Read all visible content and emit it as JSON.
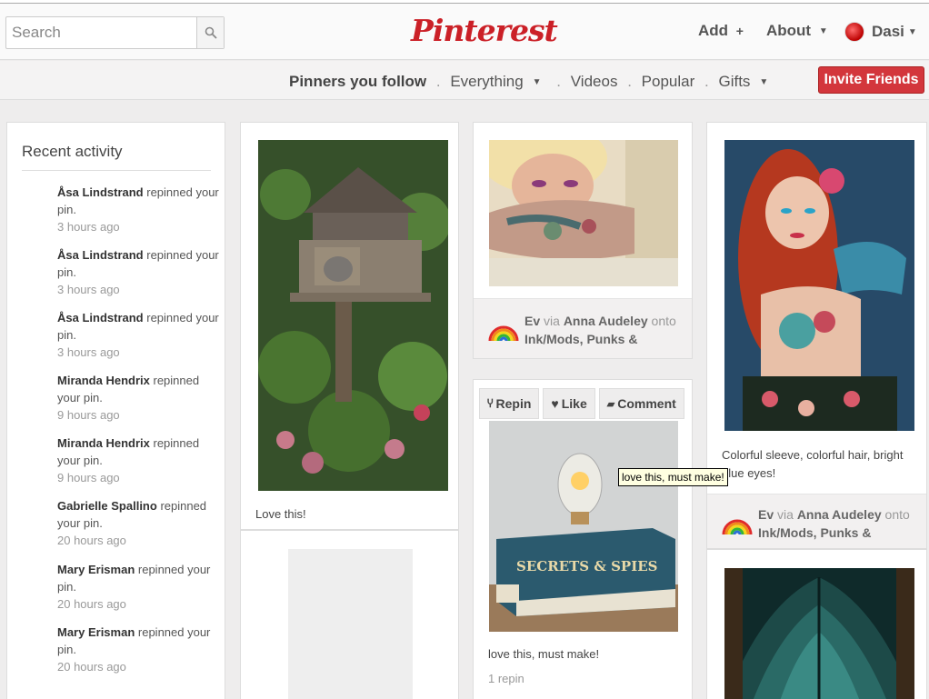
{
  "header": {
    "search_placeholder": "Search",
    "logo": "Pinterest",
    "add_label": "Add",
    "about_label": "About",
    "user_name": "Dasi"
  },
  "subnav": {
    "items": [
      "Pinners you follow",
      "Everything",
      "Videos",
      "Popular",
      "Gifts"
    ],
    "invite_label": "Invite Friends"
  },
  "activity": {
    "title": "Recent activity",
    "items": [
      {
        "name": "Åsa Lindstrand",
        "action": "repinned your pin.",
        "time": "3 hours ago"
      },
      {
        "name": "Åsa Lindstrand",
        "action": "repinned your pin.",
        "time": "3 hours ago"
      },
      {
        "name": "Åsa Lindstrand",
        "action": "repinned your pin.",
        "time": "3 hours ago"
      },
      {
        "name": "Miranda Hendrix",
        "action": "repinned your pin.",
        "time": "9 hours ago"
      },
      {
        "name": "Miranda Hendrix",
        "action": "repinned your pin.",
        "time": "9 hours ago"
      },
      {
        "name": "Gabrielle Spallino",
        "action": "repinned your pin.",
        "time": "20 hours ago"
      },
      {
        "name": "Mary Erisman",
        "action": "repinned your pin.",
        "time": "20 hours ago"
      },
      {
        "name": "Mary Erisman",
        "action": "repinned your pin.",
        "time": "20 hours ago"
      }
    ]
  },
  "pins": {
    "birdhouse_desc": "Love this!",
    "tattoo1": {
      "user": "Ev",
      "via": "via",
      "source": "Anna Audeley",
      "onto": "onto",
      "board": "Ink/Mods, Punks &"
    },
    "lamp": {
      "repin": "Repin",
      "like": "Like",
      "comment": "Comment",
      "tooltip": "love this, must make!",
      "desc": "love this, must make!",
      "repins": "1 repin",
      "book_title": "SECRETS & SPIES"
    },
    "tattoo2": {
      "desc": "Colorful sleeve, colorful hair, bright blue eyes!",
      "user": "Ev",
      "via": "via",
      "source": "Anna Audeley",
      "onto": "onto",
      "board": "Ink/Mods, Punks &"
    }
  }
}
